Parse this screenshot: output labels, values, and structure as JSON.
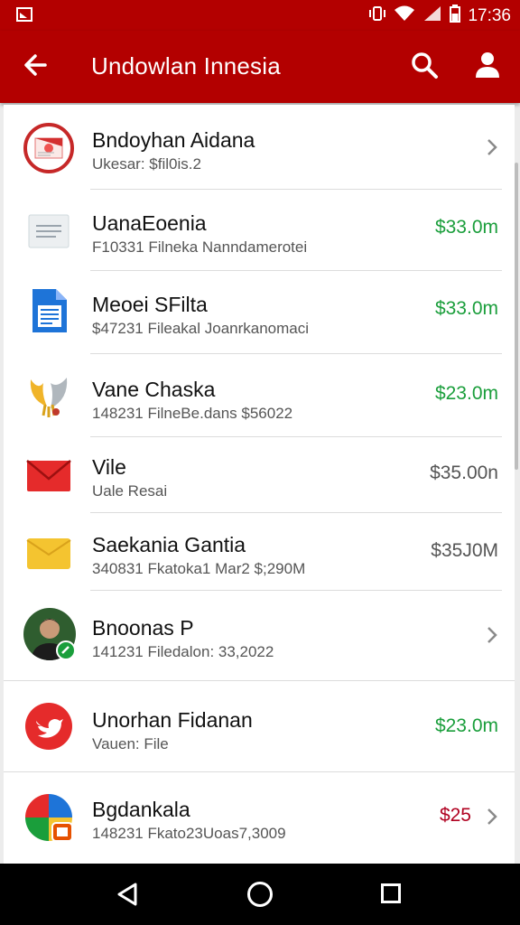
{
  "status_bar": {
    "time": "17:36",
    "icons": [
      "image-icon",
      "vibrate-icon",
      "wifi-icon",
      "signal-icon",
      "battery-icon"
    ]
  },
  "toolbar": {
    "title": "Undowlan Innesia",
    "icons": [
      "back-arrow-icon",
      "search-icon",
      "account-icon"
    ]
  },
  "colors": {
    "accent": "#b30000",
    "positive": "#1a9e3b",
    "negative": "#b00020",
    "neutral": "#555555"
  },
  "items": [
    {
      "name": "Bndoyhan Aidana",
      "sub": "Ukesar: $fil0is.2",
      "amount": "",
      "trailing": "chevron"
    },
    {
      "name": "UanaEoenia",
      "sub": "F10331 Filneka Nanndamerotei",
      "amount": "$33.0m",
      "trailing": "amount-green"
    },
    {
      "name": "Meoei SFilta",
      "sub": "$47231 Fileakal Joanrkanomaci",
      "amount": "$33.0m",
      "trailing": "amount-green"
    },
    {
      "name": "Vane Chaska",
      "sub": "148231 FilneBe.dans $56022",
      "amount": "$23.0m",
      "trailing": "amount-green"
    },
    {
      "name": "Vile",
      "sub": "Uale Resai",
      "amount": "$35.00n",
      "trailing": "amount-gray"
    },
    {
      "name": "Saekania Gantia",
      "sub": "340831 Fkatoka1 Mar2 $;290M",
      "amount": "$35J0M",
      "trailing": "amount-gray"
    },
    {
      "name": "Bnoonas P",
      "sub": "141231 Filedalon: 33,2022",
      "amount": "",
      "trailing": "chevron"
    },
    {
      "name": "Unorhan Fidanan",
      "sub": "Vauen: File",
      "amount": "$23.0m",
      "trailing": "amount-green"
    },
    {
      "name": "Bgdankala",
      "sub": "148231 Fkato23Uoas7,3009",
      "amount": "$25",
      "trailing": "amount-red-chevron"
    }
  ]
}
